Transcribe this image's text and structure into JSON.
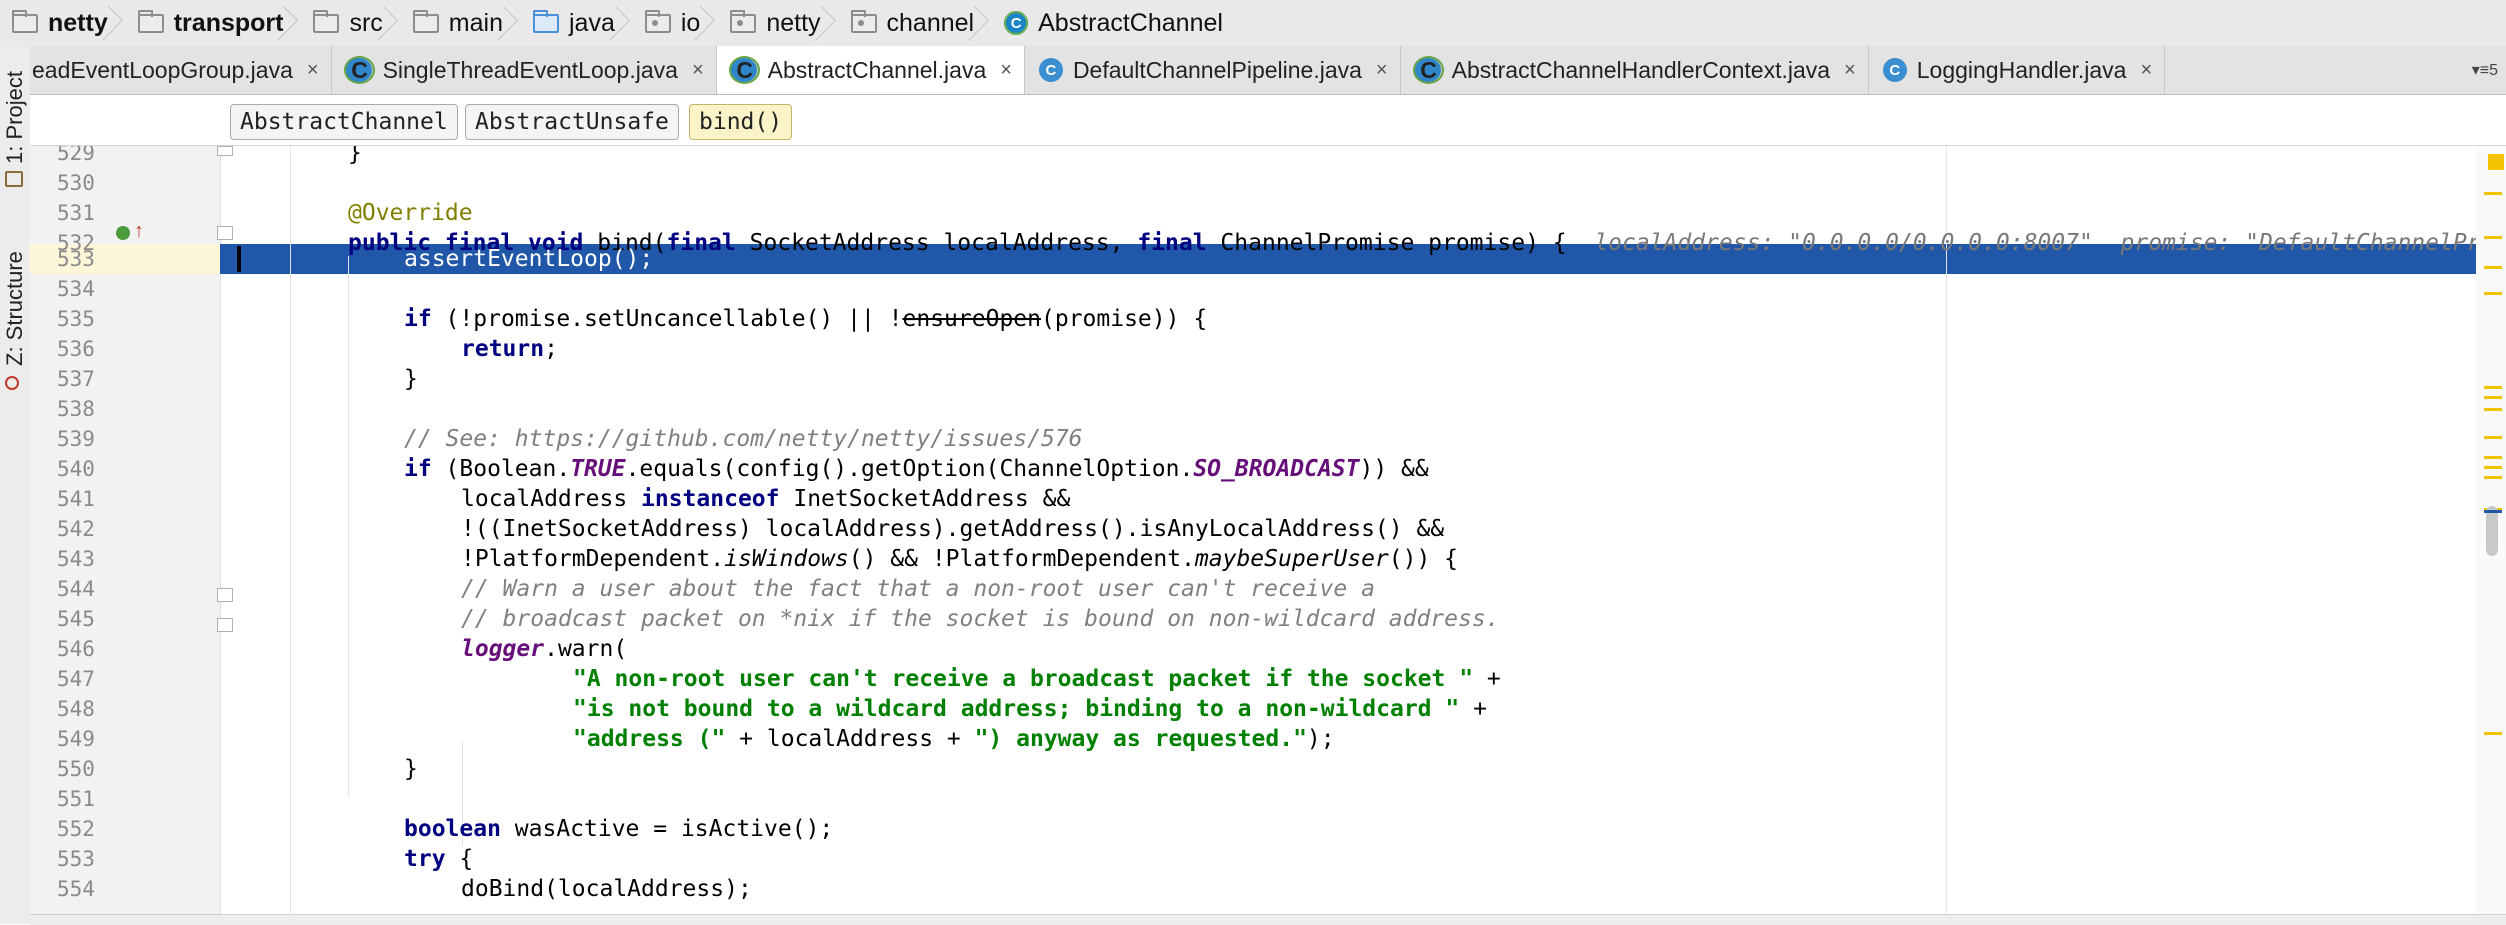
{
  "breadcrumb": [
    {
      "label": "netty",
      "icon": "module-folder-icon"
    },
    {
      "label": "transport",
      "icon": "module-folder-icon"
    },
    {
      "label": "src",
      "icon": "folder-icon"
    },
    {
      "label": "main",
      "icon": "folder-icon"
    },
    {
      "label": "java",
      "icon": "source-folder-icon"
    },
    {
      "label": "io",
      "icon": "package-folder-icon"
    },
    {
      "label": "netty",
      "icon": "package-folder-icon"
    },
    {
      "label": "channel",
      "icon": "package-folder-icon"
    },
    {
      "label": "AbstractChannel",
      "icon": "class-icon"
    }
  ],
  "tool_windows": {
    "project": "1: Project",
    "structure": "Z: Structure"
  },
  "tabs": [
    {
      "label": "eadEventLoopGroup.java",
      "active": false
    },
    {
      "label": "SingleThreadEventLoop.java",
      "active": false
    },
    {
      "label": "AbstractChannel.java",
      "active": true
    },
    {
      "label": "DefaultChannelPipeline.java",
      "active": false
    },
    {
      "label": "AbstractChannelHandlerContext.java",
      "active": false
    },
    {
      "label": "LoggingHandler.java",
      "active": false
    }
  ],
  "tab_close": "×",
  "tab_overflow": "▾≡5",
  "method_breadcrumbs": [
    "AbstractChannel",
    "AbstractUnsafe",
    "bind()"
  ],
  "line_numbers": [
    "529",
    "530",
    "531",
    "532",
    "533",
    "534",
    "535",
    "536",
    "537",
    "538",
    "539",
    "540",
    "541",
    "542",
    "543",
    "544",
    "545",
    "546",
    "547",
    "548",
    "549",
    "550",
    "551",
    "552",
    "553",
    "554"
  ],
  "code": {
    "l529": "}",
    "l531": "@Override",
    "l532_a": "public final void",
    "l532_b": " bind(",
    "l532_c": "final",
    "l532_d": " SocketAddress localAddress, ",
    "l532_e": "final",
    "l532_f": " ChannelPromise promise) {",
    "l532_hint": "localAddress: \"0.0.0.0/0.0.0.0:8007\"  promise: \"DefaultChannelPr",
    "l533": "assertEventLoop();",
    "l535_a": "if",
    "l535_b": " (!promise.setUncancellable() || !",
    "l535_c": "ensureOpen",
    "l535_d": "(promise)) {",
    "l536_a": "return",
    "l536_b": ";",
    "l537": "}",
    "l539": "// See: https://github.com/netty/netty/issues/576",
    "l540_a": "if",
    "l540_b": " (Boolean.",
    "l540_c": "TRUE",
    "l540_d": ".equals(config().getOption(ChannelOption.",
    "l540_e": "SO_BROADCAST",
    "l540_f": ")) &&",
    "l541_a": "localAddress ",
    "l541_b": "instanceof",
    "l541_c": " InetSocketAddress &&",
    "l542": "!((InetSocketAddress) localAddress).getAddress().isAnyLocalAddress() &&",
    "l543_a": "!PlatformDependent.",
    "l543_b": "isWindows",
    "l543_c": "() && !PlatformDependent.",
    "l543_d": "maybeSuperUser",
    "l543_e": "()) {",
    "l544": "// Warn a user about the fact that a non-root user can't receive a",
    "l545": "// broadcast packet on *nix if the socket is bound on non-wildcard address.",
    "l546_a": "logger",
    "l546_b": ".warn(",
    "l547_a": "\"A non-root user can't receive a broadcast packet if the socket \"",
    "l547_b": " +",
    "l548_a": "\"is not bound to a wildcard address; binding to a non-wildcard \"",
    "l548_b": " +",
    "l549_a": "\"address (\"",
    "l549_b": " + localAddress + ",
    "l549_c": "\") anyway as requested.\"",
    "l549_d": ");",
    "l550": "}",
    "l552_a": "boolean",
    "l552_b": " wasActive = isActive();",
    "l553_a": "try",
    "l553_b": " {",
    "l554": "doBind(localAddress);"
  },
  "colors": {
    "selection": "#2157a8",
    "keyword": "#000080",
    "string": "#008000",
    "comment": "#808080",
    "annotation": "#808000",
    "static_field": "#660e7a",
    "current_line_gutter": "#fdf6d8"
  }
}
